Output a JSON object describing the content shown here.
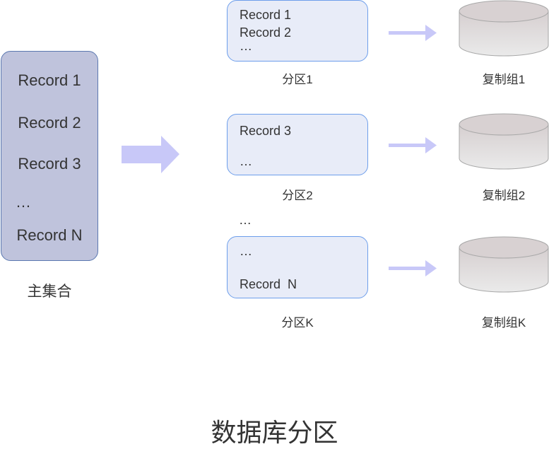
{
  "title": "数据库分区",
  "master": {
    "caption": "主集合",
    "records": [
      "Record 1",
      "Record 2",
      "Record 3",
      "…",
      "Record N"
    ]
  },
  "partitions": [
    {
      "caption": "分区1",
      "lines": [
        "Record 1",
        "Record 2",
        "…"
      ],
      "replica": "复制组1"
    },
    {
      "caption": "分区2",
      "lines": [
        "Record 3",
        "…"
      ],
      "replica": "复制组2"
    },
    {
      "caption": "分区K",
      "lines": [
        "…",
        "Record  N"
      ],
      "replica": "复制组K"
    }
  ],
  "between_partitions_ellipsis": "…",
  "colors": {
    "master_fill": "#bfc3dc",
    "master_border": "#5b78b0",
    "partition_fill": "#e8ecf8",
    "partition_border": "#6d9eeb",
    "arrow": "#c8c8f8",
    "cylinder": "#dcd8d8"
  }
}
